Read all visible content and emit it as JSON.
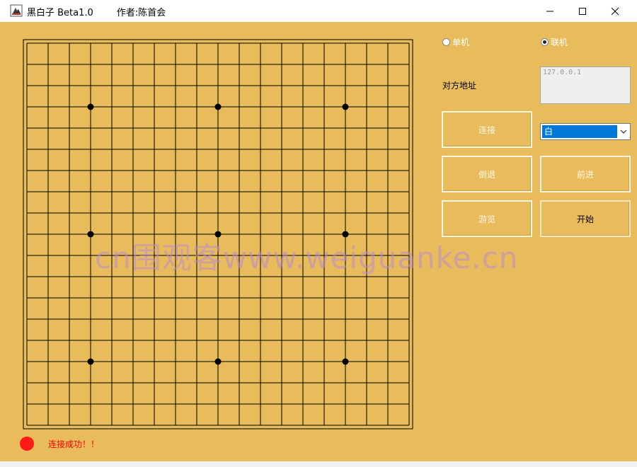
{
  "window": {
    "title": "黑白子 Beta1.0        作者:陈首会"
  },
  "board": {
    "size": 19,
    "star_points": [
      [
        3,
        3
      ],
      [
        9,
        3
      ],
      [
        15,
        3
      ],
      [
        3,
        9
      ],
      [
        9,
        9
      ],
      [
        15,
        9
      ],
      [
        3,
        15
      ],
      [
        9,
        15
      ],
      [
        15,
        15
      ]
    ]
  },
  "mode": {
    "single_label": "单机",
    "network_label": "联机",
    "selected": "network"
  },
  "address": {
    "label": "对方地址",
    "value": "127.0.0.1"
  },
  "buttons": {
    "connect": "连接",
    "undo": "倒退",
    "forward": "前进",
    "replay": "游览",
    "start": "开始"
  },
  "color_select": {
    "value": "白"
  },
  "status": {
    "message": "连接成功！！",
    "indicator_color": "#ff1a1a"
  },
  "watermark": "cn围观客www.weiguanke.cn"
}
